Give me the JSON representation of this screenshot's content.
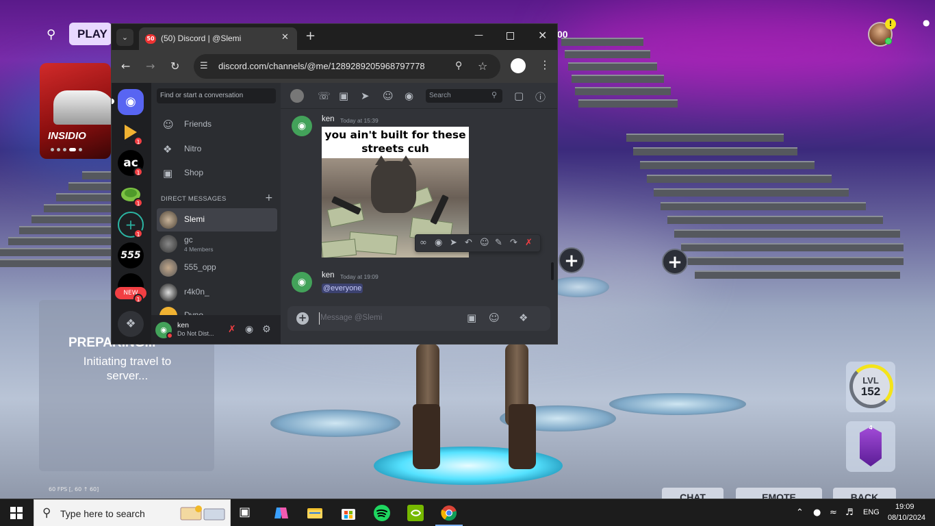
{
  "game": {
    "play_label": "PLAY",
    "vbucks_partial": "00",
    "banner_title": "INSIDIO",
    "preparing_title": "PREPARING...",
    "preparing_sub": "Initiating travel to server...",
    "fps": "60 FPS [, 60 ↑ 60]",
    "level_label": "LVL",
    "level_value": "152",
    "level_progress": 0.3,
    "rank_value": "4",
    "bottom_buttons": [
      "CHAT",
      "EMOTE",
      "BACK"
    ]
  },
  "browser": {
    "tab_title": "(50) Discord | @Slemi",
    "tab_badge": "50",
    "url": "discord.com/channels/@me/1289289205968797778"
  },
  "discord": {
    "server_badges": [
      "1",
      "1",
      "1",
      "1",
      "1"
    ],
    "server_new": "NEW",
    "dm_search_placeholder": "Find or start a conversation",
    "nav": [
      {
        "label": "Friends",
        "icon": "friends-icon"
      },
      {
        "label": "Nitro",
        "icon": "nitro-icon"
      },
      {
        "label": "Shop",
        "icon": "shop-icon"
      }
    ],
    "dm_header": "DIRECT MESSAGES",
    "dm_list": [
      {
        "name": "Slemi",
        "sub": ""
      },
      {
        "name": "gc",
        "sub": "4 Members"
      },
      {
        "name": "555_opp",
        "sub": ""
      },
      {
        "name": "r4k0n_",
        "sub": ""
      },
      {
        "name": "Dyno",
        "sub": ""
      }
    ],
    "user": {
      "name": "ken",
      "status": "Do Not Dist..."
    },
    "chat_search_placeholder": "Search",
    "messages": [
      {
        "author": "ken",
        "time": "Today at 15:39"
      },
      {
        "author": "ken",
        "time": "Today at 19:09",
        "text": "@everyone"
      }
    ],
    "meme_caption": "you ain't built for these streets cuh",
    "composer_placeholder": "Message @Slemi"
  },
  "taskbar": {
    "search_placeholder": "Type here to search",
    "language": "ENG",
    "time": "19:09",
    "date": "08/10/2024"
  }
}
